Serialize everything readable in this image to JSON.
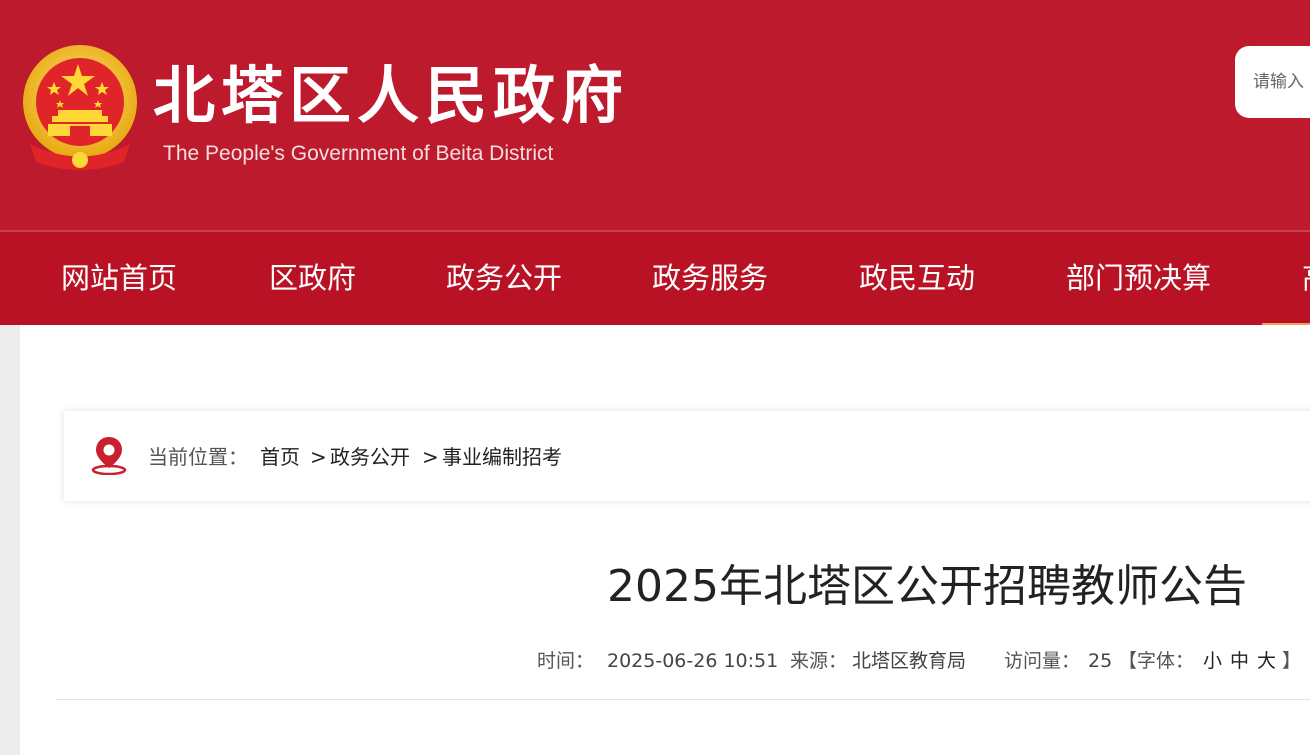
{
  "header": {
    "title": "北塔区人民政府",
    "subtitle": "The People's Government of Beita District",
    "search_placeholder": "请输入",
    "colors": {
      "primary_red": "#bd1a2e",
      "nav_red": "#b81224",
      "gold": "#f4c020"
    }
  },
  "nav": {
    "items": [
      "网站首页",
      "区政府",
      "政务公开",
      "政务服务",
      "政民互动",
      "部门预决算",
      "高"
    ]
  },
  "breadcrumb": {
    "label": "当前位置：",
    "items": [
      "首页",
      "政务公开",
      "事业编制招考"
    ],
    "separator": ">"
  },
  "article": {
    "title": "2025年北塔区公开招聘教师公告",
    "time_label": "时间：",
    "time": "2025-06-26 10:51",
    "source_label": "来源：",
    "source": "北塔区教育局",
    "views_label": "访问量：",
    "views": "25",
    "font_label": "【字体：",
    "font_small": "小",
    "font_medium": "中",
    "font_large": "大",
    "font_close": "】"
  },
  "icons": {
    "emblem": "national-emblem-icon",
    "location": "location-pin-icon"
  }
}
